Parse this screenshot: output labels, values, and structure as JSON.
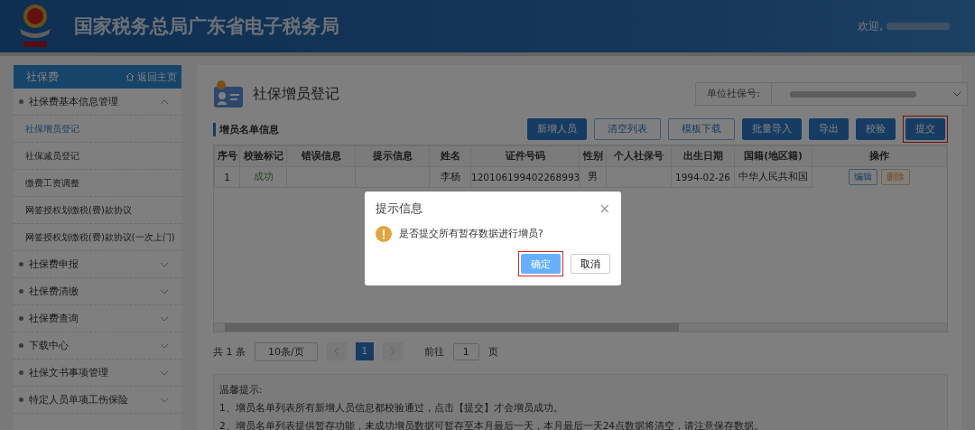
{
  "header": {
    "title": "国家税务总局广东省电子税务局",
    "welcome": "欢迎,"
  },
  "sidebar": {
    "title": "社保费",
    "home_link": "返回主页",
    "groups": [
      {
        "label": "社保费基本信息管理",
        "expanded": true,
        "children": [
          {
            "label": "社保增员登记",
            "selected": true
          },
          {
            "label": "社保减员登记",
            "selected": false
          },
          {
            "label": "缴费工资调整",
            "selected": false
          },
          {
            "label": "网签授权划缴税(费)款协议",
            "selected": false
          },
          {
            "label": "网签授权划缴税(费)款协议(一次上门)",
            "selected": false
          }
        ]
      },
      {
        "label": "社保费申报",
        "expanded": false
      },
      {
        "label": "社保费清缴",
        "expanded": false
      },
      {
        "label": "社保费查询",
        "expanded": false
      },
      {
        "label": "下载中心",
        "expanded": false
      },
      {
        "label": "社保文书事项管理",
        "expanded": false
      },
      {
        "label": "特定人员单项工伤保险",
        "expanded": false
      }
    ]
  },
  "page": {
    "title": "社保增员登记",
    "unit_label": "单位社保号:",
    "section_title": "增员名单信息"
  },
  "toolbar": [
    {
      "label": "新增人员",
      "kind": "primary",
      "highlighted": false
    },
    {
      "label": "清空列表",
      "kind": "outline",
      "highlighted": false
    },
    {
      "label": "模板下载",
      "kind": "outline",
      "highlighted": false
    },
    {
      "label": "批量导入",
      "kind": "primary",
      "highlighted": false
    },
    {
      "label": "导出",
      "kind": "primary",
      "highlighted": false
    },
    {
      "label": "校验",
      "kind": "primary",
      "highlighted": false
    },
    {
      "label": "提交",
      "kind": "primary",
      "highlighted": true
    }
  ],
  "table": {
    "columns": [
      "序号",
      "校验标记",
      "错误信息",
      "提示信息",
      "姓名",
      "证件号码",
      "性别",
      "个人社保号",
      "出生日期",
      "国籍(地区籍)",
      "操作"
    ],
    "rows": [
      {
        "cells": [
          "1",
          "成功",
          "",
          "",
          "李杨",
          "120106199402268993",
          "男",
          "",
          "1994-02-26",
          "中华人民共和国"
        ],
        "actions": [
          {
            "label": "编辑",
            "kind": "edit"
          },
          {
            "label": "删除",
            "kind": "delete"
          }
        ]
      }
    ]
  },
  "pagination": {
    "total": "共 1 条",
    "page_size": "10条/页",
    "pages": [
      {
        "label": "1",
        "selected": true
      }
    ],
    "goto_label": "前往",
    "goto_value": "1",
    "goto_suffix": "页"
  },
  "tips": {
    "title": "温馨提示:",
    "lines": [
      "1、增员名单列表所有新增人员信息都校验通过，点击【提交】才会增员成功。",
      "2、增员名单列表提供暂存功能，未成功增员数据可暂存至本月最后一天，本月最后一天24点数据将清空，请注意保存数据。"
    ]
  },
  "dialog": {
    "title": "提示信息",
    "close": "×",
    "message": "是否提交所有暂存数据进行增员?",
    "buttons": [
      {
        "label": "确定",
        "kind": "primary",
        "highlighted": true
      },
      {
        "label": "取消",
        "kind": "default",
        "highlighted": false
      }
    ]
  }
}
